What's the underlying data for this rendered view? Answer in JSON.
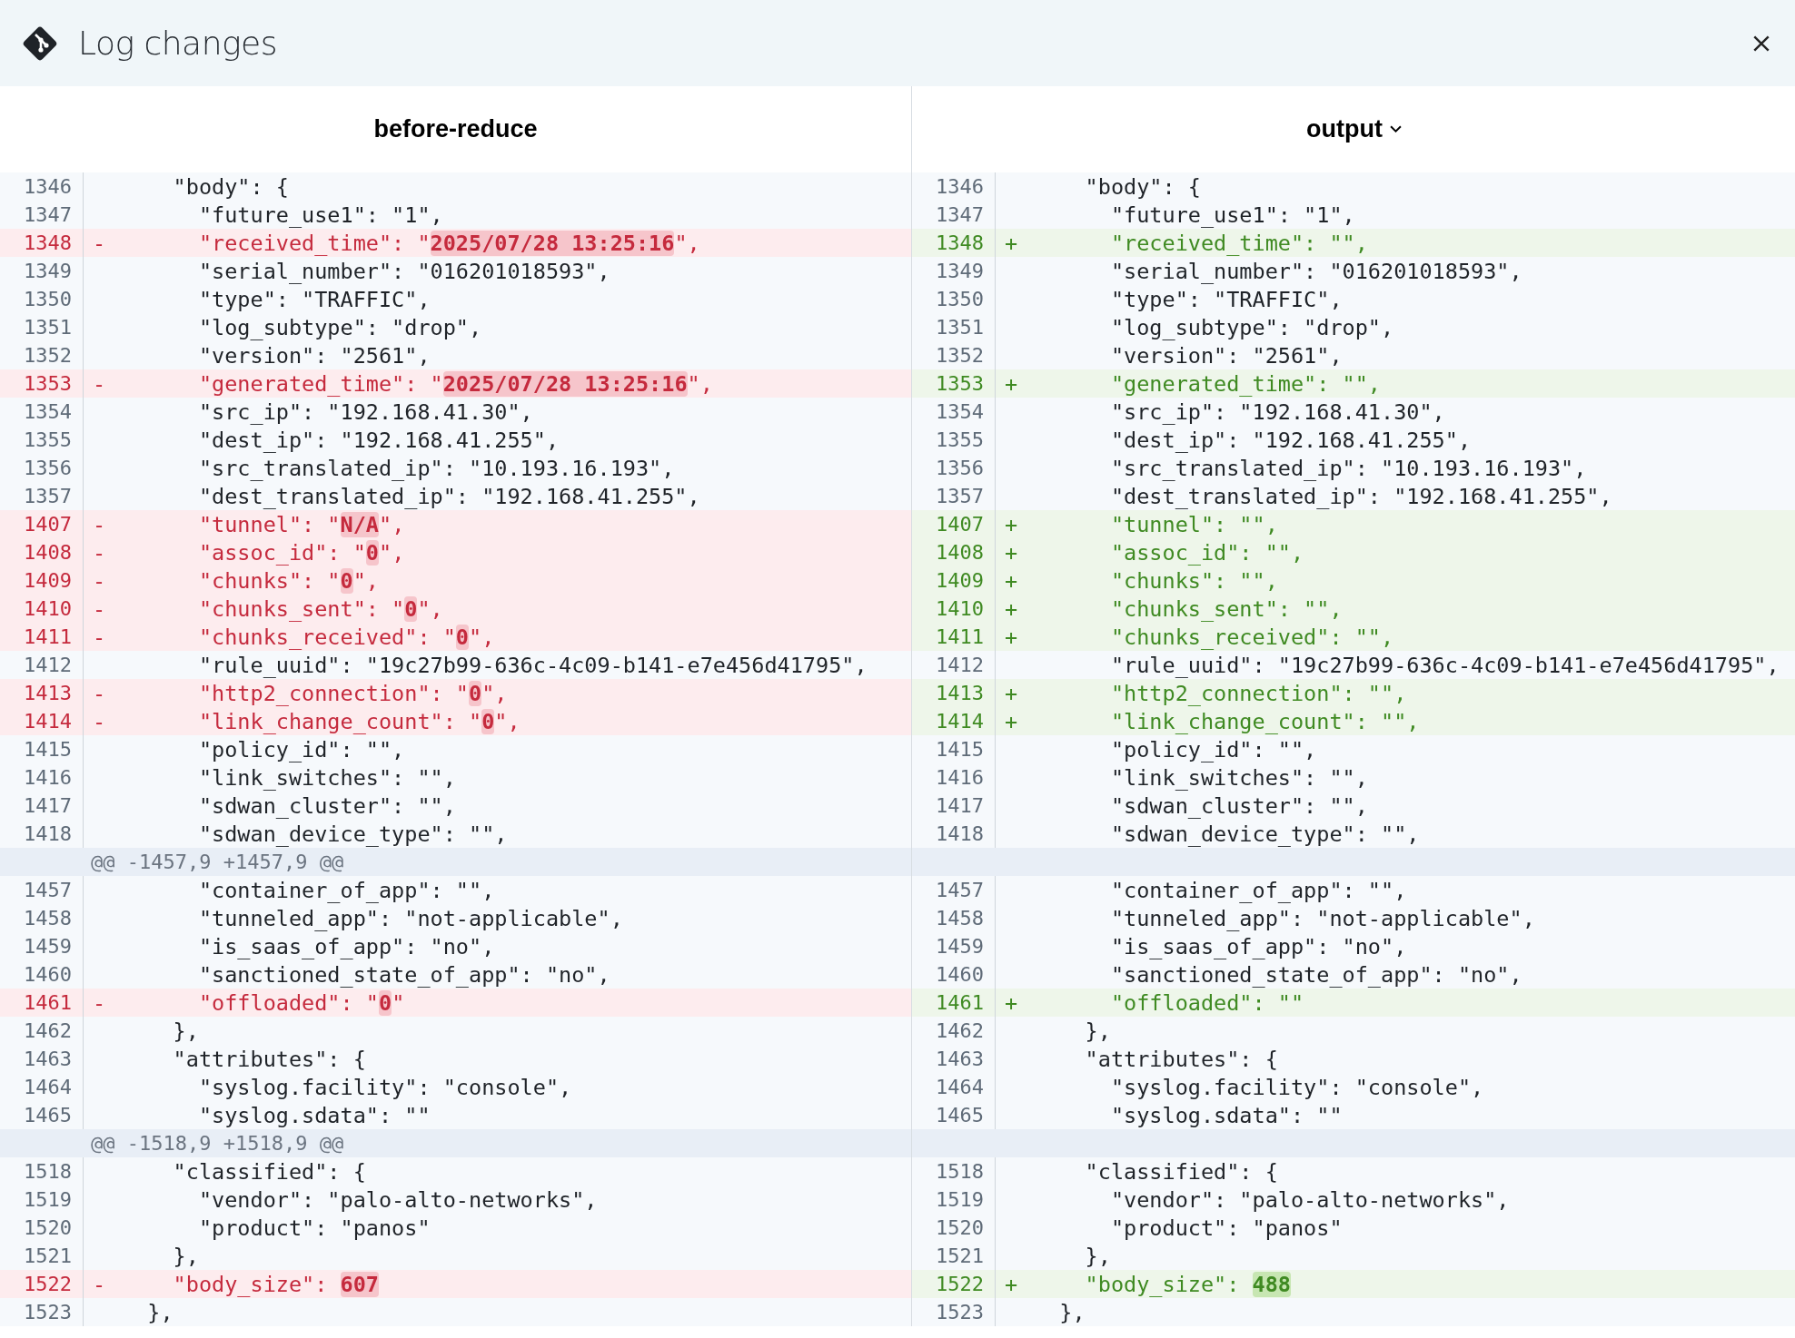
{
  "window": {
    "title": "Log changes"
  },
  "panes": [
    {
      "title": "before-reduce",
      "dropdown": false,
      "rows": [
        {
          "kind": "context",
          "number": "1346",
          "text": "    \"body\": {"
        },
        {
          "kind": "context",
          "number": "1347",
          "text": "      \"future_use1\": \"1\","
        },
        {
          "kind": "removed",
          "number": "1348",
          "marker": "-",
          "segments": [
            {
              "text": "      \"received_time\": \"",
              "changed": false
            },
            {
              "text": "2025/07/28 13:25:16",
              "changed": true
            },
            {
              "text": "\",",
              "changed": false
            }
          ]
        },
        {
          "kind": "context",
          "number": "1349",
          "text": "      \"serial_number\": \"016201018593\","
        },
        {
          "kind": "context",
          "number": "1350",
          "text": "      \"type\": \"TRAFFIC\","
        },
        {
          "kind": "context",
          "number": "1351",
          "text": "      \"log_subtype\": \"drop\","
        },
        {
          "kind": "context",
          "number": "1352",
          "text": "      \"version\": \"2561\","
        },
        {
          "kind": "removed",
          "number": "1353",
          "marker": "-",
          "segments": [
            {
              "text": "      \"generated_time\": \"",
              "changed": false
            },
            {
              "text": "2025/07/28 13:25:16",
              "changed": true
            },
            {
              "text": "\",",
              "changed": false
            }
          ]
        },
        {
          "kind": "context",
          "number": "1354",
          "text": "      \"src_ip\": \"192.168.41.30\","
        },
        {
          "kind": "context",
          "number": "1355",
          "text": "      \"dest_ip\": \"192.168.41.255\","
        },
        {
          "kind": "context",
          "number": "1356",
          "text": "      \"src_translated_ip\": \"10.193.16.193\","
        },
        {
          "kind": "context",
          "number": "1357",
          "text": "      \"dest_translated_ip\": \"192.168.41.255\","
        },
        {
          "kind": "removed",
          "number": "1407",
          "marker": "-",
          "segments": [
            {
              "text": "      \"tunnel\": \"",
              "changed": false
            },
            {
              "text": "N/A",
              "changed": true
            },
            {
              "text": "\",",
              "changed": false
            }
          ]
        },
        {
          "kind": "removed",
          "number": "1408",
          "marker": "-",
          "segments": [
            {
              "text": "      \"assoc_id\": \"",
              "changed": false
            },
            {
              "text": "0",
              "changed": true
            },
            {
              "text": "\",",
              "changed": false
            }
          ]
        },
        {
          "kind": "removed",
          "number": "1409",
          "marker": "-",
          "segments": [
            {
              "text": "      \"chunks\": \"",
              "changed": false
            },
            {
              "text": "0",
              "changed": true
            },
            {
              "text": "\",",
              "changed": false
            }
          ]
        },
        {
          "kind": "removed",
          "number": "1410",
          "marker": "-",
          "segments": [
            {
              "text": "      \"chunks_sent\": \"",
              "changed": false
            },
            {
              "text": "0",
              "changed": true
            },
            {
              "text": "\",",
              "changed": false
            }
          ]
        },
        {
          "kind": "removed",
          "number": "1411",
          "marker": "-",
          "segments": [
            {
              "text": "      \"chunks_received\": \"",
              "changed": false
            },
            {
              "text": "0",
              "changed": true
            },
            {
              "text": "\",",
              "changed": false
            }
          ]
        },
        {
          "kind": "context",
          "number": "1412",
          "text": "      \"rule_uuid\": \"19c27b99-636c-4c09-b141-e7e456d41795\","
        },
        {
          "kind": "removed",
          "number": "1413",
          "marker": "-",
          "segments": [
            {
              "text": "      \"http2_connection\": \"",
              "changed": false
            },
            {
              "text": "0",
              "changed": true
            },
            {
              "text": "\",",
              "changed": false
            }
          ]
        },
        {
          "kind": "removed",
          "number": "1414",
          "marker": "-",
          "segments": [
            {
              "text": "      \"link_change_count\": \"",
              "changed": false
            },
            {
              "text": "0",
              "changed": true
            },
            {
              "text": "\",",
              "changed": false
            }
          ]
        },
        {
          "kind": "context",
          "number": "1415",
          "text": "      \"policy_id\": \"\","
        },
        {
          "kind": "context",
          "number": "1416",
          "text": "      \"link_switches\": \"\","
        },
        {
          "kind": "context",
          "number": "1417",
          "text": "      \"sdwan_cluster\": \"\","
        },
        {
          "kind": "context",
          "number": "1418",
          "text": "      \"sdwan_device_type\": \"\","
        },
        {
          "kind": "hunk",
          "text": "@@ -1457,9 +1457,9 @@"
        },
        {
          "kind": "context",
          "number": "1457",
          "text": "      \"container_of_app\": \"\","
        },
        {
          "kind": "context",
          "number": "1458",
          "text": "      \"tunneled_app\": \"not-applicable\","
        },
        {
          "kind": "context",
          "number": "1459",
          "text": "      \"is_saas_of_app\": \"no\","
        },
        {
          "kind": "context",
          "number": "1460",
          "text": "      \"sanctioned_state_of_app\": \"no\","
        },
        {
          "kind": "removed",
          "number": "1461",
          "marker": "-",
          "segments": [
            {
              "text": "      \"offloaded\": \"",
              "changed": false
            },
            {
              "text": "0",
              "changed": true
            },
            {
              "text": "\"",
              "changed": false
            }
          ]
        },
        {
          "kind": "context",
          "number": "1462",
          "text": "    },"
        },
        {
          "kind": "context",
          "number": "1463",
          "text": "    \"attributes\": {"
        },
        {
          "kind": "context",
          "number": "1464",
          "text": "      \"syslog.facility\": \"console\","
        },
        {
          "kind": "context",
          "number": "1465",
          "text": "      \"syslog.sdata\": \"\""
        },
        {
          "kind": "hunk",
          "text": "@@ -1518,9 +1518,9 @@"
        },
        {
          "kind": "context",
          "number": "1518",
          "text": "    \"classified\": {"
        },
        {
          "kind": "context",
          "number": "1519",
          "text": "      \"vendor\": \"palo-alto-networks\","
        },
        {
          "kind": "context",
          "number": "1520",
          "text": "      \"product\": \"panos\""
        },
        {
          "kind": "context",
          "number": "1521",
          "text": "    },"
        },
        {
          "kind": "removed",
          "number": "1522",
          "marker": "-",
          "segments": [
            {
              "text": "    \"body_size\": ",
              "changed": false
            },
            {
              "text": "607",
              "changed": true
            }
          ]
        },
        {
          "kind": "context",
          "number": "1523",
          "text": "  },"
        }
      ]
    },
    {
      "title": "output",
      "dropdown": true,
      "rows": [
        {
          "kind": "context",
          "number": "1346",
          "text": "    \"body\": {"
        },
        {
          "kind": "context",
          "number": "1347",
          "text": "      \"future_use1\": \"1\","
        },
        {
          "kind": "added",
          "number": "1348",
          "marker": "+",
          "segments": [
            {
              "text": "      \"received_time\": \"\",",
              "changed": false
            }
          ]
        },
        {
          "kind": "context",
          "number": "1349",
          "text": "      \"serial_number\": \"016201018593\","
        },
        {
          "kind": "context",
          "number": "1350",
          "text": "      \"type\": \"TRAFFIC\","
        },
        {
          "kind": "context",
          "number": "1351",
          "text": "      \"log_subtype\": \"drop\","
        },
        {
          "kind": "context",
          "number": "1352",
          "text": "      \"version\": \"2561\","
        },
        {
          "kind": "added",
          "number": "1353",
          "marker": "+",
          "segments": [
            {
              "text": "      \"generated_time\": \"\",",
              "changed": false
            }
          ]
        },
        {
          "kind": "context",
          "number": "1354",
          "text": "      \"src_ip\": \"192.168.41.30\","
        },
        {
          "kind": "context",
          "number": "1355",
          "text": "      \"dest_ip\": \"192.168.41.255\","
        },
        {
          "kind": "context",
          "number": "1356",
          "text": "      \"src_translated_ip\": \"10.193.16.193\","
        },
        {
          "kind": "context",
          "number": "1357",
          "text": "      \"dest_translated_ip\": \"192.168.41.255\","
        },
        {
          "kind": "added",
          "number": "1407",
          "marker": "+",
          "segments": [
            {
              "text": "      \"tunnel\": \"\",",
              "changed": false
            }
          ]
        },
        {
          "kind": "added",
          "number": "1408",
          "marker": "+",
          "segments": [
            {
              "text": "      \"assoc_id\": \"\",",
              "changed": false
            }
          ]
        },
        {
          "kind": "added",
          "number": "1409",
          "marker": "+",
          "segments": [
            {
              "text": "      \"chunks\": \"\",",
              "changed": false
            }
          ]
        },
        {
          "kind": "added",
          "number": "1410",
          "marker": "+",
          "segments": [
            {
              "text": "      \"chunks_sent\": \"\",",
              "changed": false
            }
          ]
        },
        {
          "kind": "added",
          "number": "1411",
          "marker": "+",
          "segments": [
            {
              "text": "      \"chunks_received\": \"\",",
              "changed": false
            }
          ]
        },
        {
          "kind": "context",
          "number": "1412",
          "text": "      \"rule_uuid\": \"19c27b99-636c-4c09-b141-e7e456d41795\","
        },
        {
          "kind": "added",
          "number": "1413",
          "marker": "+",
          "segments": [
            {
              "text": "      \"http2_connection\": \"\",",
              "changed": false
            }
          ]
        },
        {
          "kind": "added",
          "number": "1414",
          "marker": "+",
          "segments": [
            {
              "text": "      \"link_change_count\": \"\",",
              "changed": false
            }
          ]
        },
        {
          "kind": "context",
          "number": "1415",
          "text": "      \"policy_id\": \"\","
        },
        {
          "kind": "context",
          "number": "1416",
          "text": "      \"link_switches\": \"\","
        },
        {
          "kind": "context",
          "number": "1417",
          "text": "      \"sdwan_cluster\": \"\","
        },
        {
          "kind": "context",
          "number": "1418",
          "text": "      \"sdwan_device_type\": \"\","
        },
        {
          "kind": "hunk"
        },
        {
          "kind": "context",
          "number": "1457",
          "text": "      \"container_of_app\": \"\","
        },
        {
          "kind": "context",
          "number": "1458",
          "text": "      \"tunneled_app\": \"not-applicable\","
        },
        {
          "kind": "context",
          "number": "1459",
          "text": "      \"is_saas_of_app\": \"no\","
        },
        {
          "kind": "context",
          "number": "1460",
          "text": "      \"sanctioned_state_of_app\": \"no\","
        },
        {
          "kind": "added",
          "number": "1461",
          "marker": "+",
          "segments": [
            {
              "text": "      \"offloaded\": \"\"",
              "changed": false
            }
          ]
        },
        {
          "kind": "context",
          "number": "1462",
          "text": "    },"
        },
        {
          "kind": "context",
          "number": "1463",
          "text": "    \"attributes\": {"
        },
        {
          "kind": "context",
          "number": "1464",
          "text": "      \"syslog.facility\": \"console\","
        },
        {
          "kind": "context",
          "number": "1465",
          "text": "      \"syslog.sdata\": \"\""
        },
        {
          "kind": "hunk"
        },
        {
          "kind": "context",
          "number": "1518",
          "text": "    \"classified\": {"
        },
        {
          "kind": "context",
          "number": "1519",
          "text": "      \"vendor\": \"palo-alto-networks\","
        },
        {
          "kind": "context",
          "number": "1520",
          "text": "      \"product\": \"panos\""
        },
        {
          "kind": "context",
          "number": "1521",
          "text": "    },"
        },
        {
          "kind": "added",
          "number": "1522",
          "marker": "+",
          "segments": [
            {
              "text": "    \"body_size\": ",
              "changed": false
            },
            {
              "text": "488",
              "changed": true
            }
          ]
        },
        {
          "kind": "context",
          "number": "1523",
          "text": "  },"
        }
      ]
    }
  ]
}
